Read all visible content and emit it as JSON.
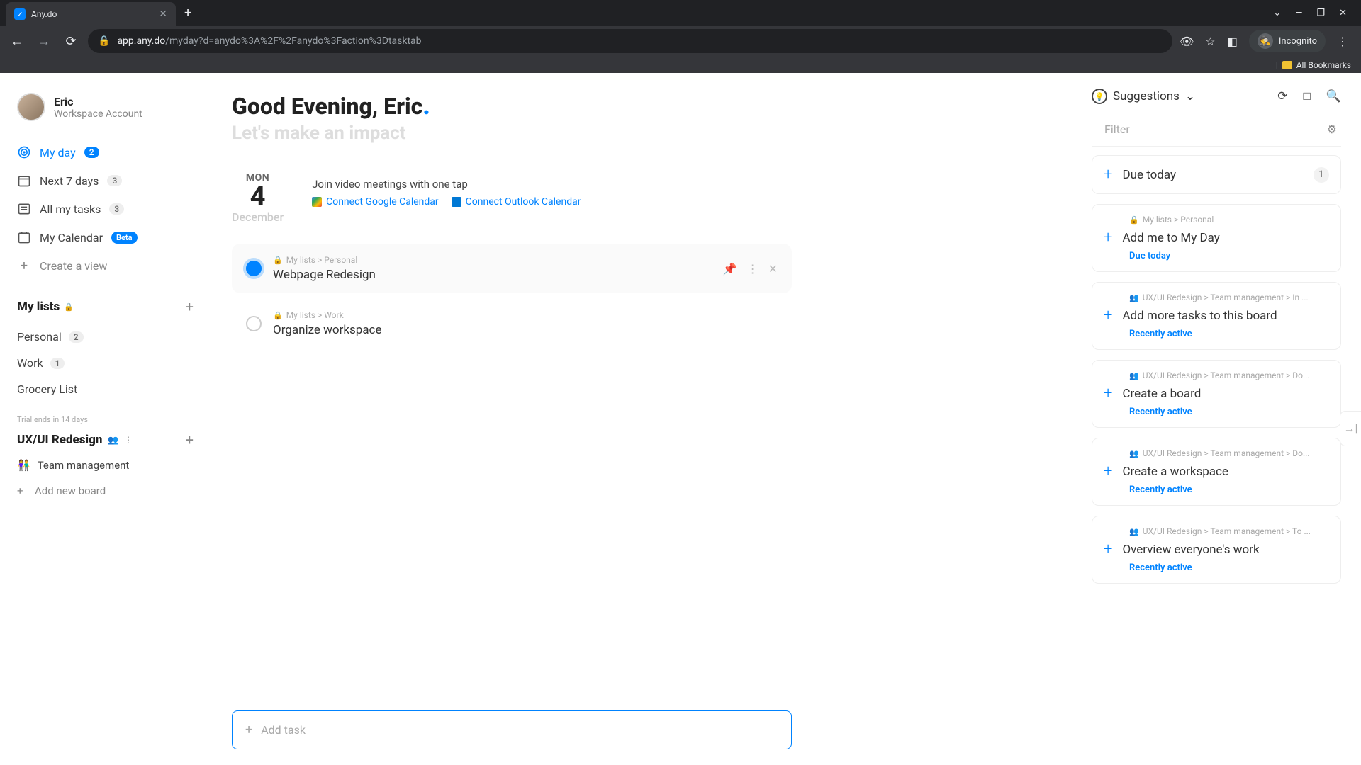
{
  "browser": {
    "tab_title": "Any.do",
    "url_domain": "app.any.do",
    "url_path": "/myday?d=anydo%3A%2F%2Fanydo%3Faction%3Dtasktab",
    "incognito_label": "Incognito",
    "bookmarks_label": "All Bookmarks"
  },
  "profile": {
    "name": "Eric",
    "account_type": "Workspace Account"
  },
  "nav": {
    "my_day": {
      "label": "My day",
      "count": "2"
    },
    "next7": {
      "label": "Next 7 days",
      "count": "3"
    },
    "all_tasks": {
      "label": "All my tasks",
      "count": "3"
    },
    "calendar": {
      "label": "My Calendar",
      "badge": "Beta"
    },
    "create_view": "Create a view"
  },
  "lists": {
    "header": "My lists",
    "personal": {
      "label": "Personal",
      "count": "2"
    },
    "work": {
      "label": "Work",
      "count": "1"
    },
    "grocery": {
      "label": "Grocery List"
    }
  },
  "workspace": {
    "trial": "Trial ends in 14 days",
    "name": "UX/UI Redesign",
    "board": "Team management",
    "add_board": "Add new board"
  },
  "main": {
    "greeting": "Good Evening, Eric",
    "tagline": "Let's make an impact",
    "weekday": "MON",
    "daynum": "4",
    "month": "December",
    "meetings_prompt": "Join video meetings with one tap",
    "google_cal": "Connect Google Calendar",
    "outlook_cal": "Connect Outlook Calendar",
    "add_task_placeholder": "Add task"
  },
  "tasks": [
    {
      "path": "My lists > Personal",
      "title": "Webpage Redesign"
    },
    {
      "path": "My lists > Work",
      "title": "Organize workspace"
    }
  ],
  "right": {
    "suggestions_label": "Suggestions",
    "filter_label": "Filter",
    "due_today": {
      "title": "Due today",
      "count": "1"
    }
  },
  "suggestions": [
    {
      "path": "My lists > Personal",
      "title": "Add me to My Day",
      "meta": "Due today"
    },
    {
      "path": "UX/UI Redesign > Team management > In ...",
      "title": "Add more tasks to this board",
      "meta": "Recently active"
    },
    {
      "path": "UX/UI Redesign > Team management > Do...",
      "title": "Create a board",
      "meta": "Recently active"
    },
    {
      "path": "UX/UI Redesign > Team management > Do...",
      "title": "Create a workspace",
      "meta": "Recently active"
    },
    {
      "path": "UX/UI Redesign > Team management > To ...",
      "title": "Overview everyone's work",
      "meta": "Recently active"
    }
  ]
}
